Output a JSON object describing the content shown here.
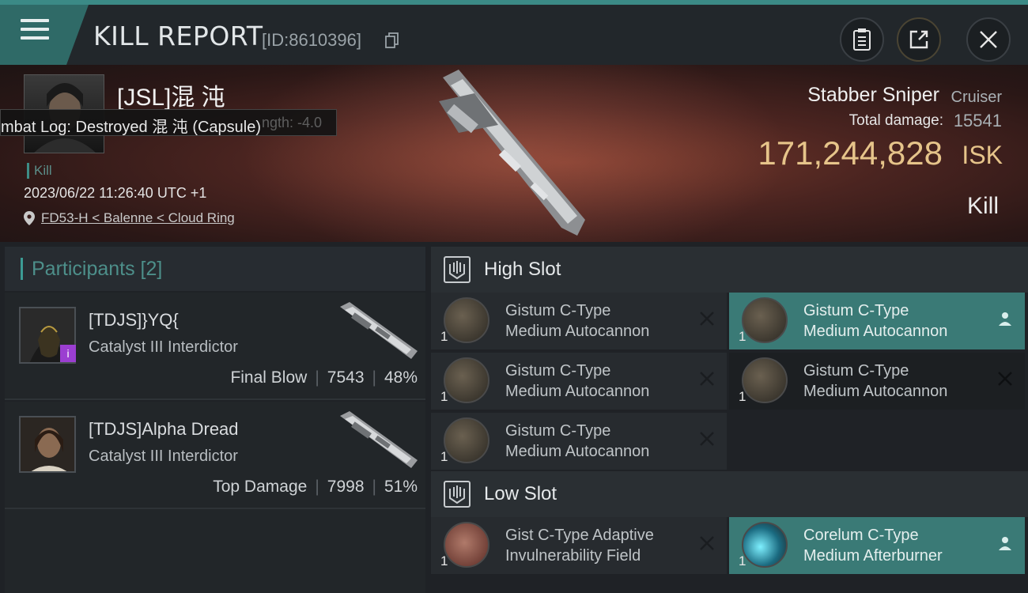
{
  "header": {
    "title": "KILL REPORT",
    "report_id": "[ID:8610396]",
    "icons": [
      "menu-icon",
      "copy-icon",
      "clipboard-icon",
      "share-icon",
      "close-icon"
    ]
  },
  "victim": {
    "name": "[JSL]混 沌",
    "tooltip": "mbat Log: Destroyed 混 沌 (Capsule)",
    "tooltip_ghost": "ngth: -4.0",
    "kill_tag": "Kill",
    "timestamp": "2023/06/22 11:26:40 UTC +1",
    "location": "FD53-H < Balenne < Cloud Ring",
    "ship_name": "Stabber Sniper",
    "ship_class": "Cruiser",
    "total_damage_label": "Total damage:",
    "total_damage": "15541",
    "isk_value": "171,244,828",
    "isk_unit": "ISK",
    "result": "Kill"
  },
  "participants": {
    "header": "Participants [2]",
    "items": [
      {
        "name": "[TDJS]}YQ{",
        "ship": "Catalyst III Interdictor",
        "role": "Final Blow",
        "damage": "7543",
        "percent": "48%",
        "badge": "i"
      },
      {
        "name": "[TDJS]Alpha Dread",
        "ship": "Catalyst III Interdictor",
        "role": "Top Damage",
        "damage": "7998",
        "percent": "51%"
      }
    ]
  },
  "slots": {
    "high": {
      "label": "High Slot",
      "modules": [
        {
          "line1": "Gistum C-Type",
          "line2": "Medium Autocannon",
          "qty": "1",
          "state": "destroyed"
        },
        {
          "line1": "Gistum C-Type",
          "line2": "Medium Autocannon",
          "qty": "1",
          "state": "dropped"
        },
        {
          "line1": "Gistum C-Type",
          "line2": "Medium Autocannon",
          "qty": "1",
          "state": "destroyed"
        },
        {
          "line1": "Gistum C-Type",
          "line2": "Medium Autocannon",
          "qty": "1",
          "state": "destroyed"
        },
        {
          "line1": "Gistum C-Type",
          "line2": "Medium Autocannon",
          "qty": "1",
          "state": "destroyed"
        }
      ]
    },
    "low": {
      "label": "Low Slot",
      "modules": [
        {
          "line1": "Gist C-Type Adaptive",
          "line2": "Invulnerability Field",
          "qty": "1",
          "state": "destroyed"
        },
        {
          "line1": "Corelum C-Type",
          "line2": "Medium Afterburner",
          "qty": "1",
          "state": "dropped"
        }
      ]
    }
  },
  "colors": {
    "accent": "#3b8a86",
    "isk": "#e6c48a",
    "highlight": "#3a7a76",
    "badge": "#9b3ed1"
  }
}
